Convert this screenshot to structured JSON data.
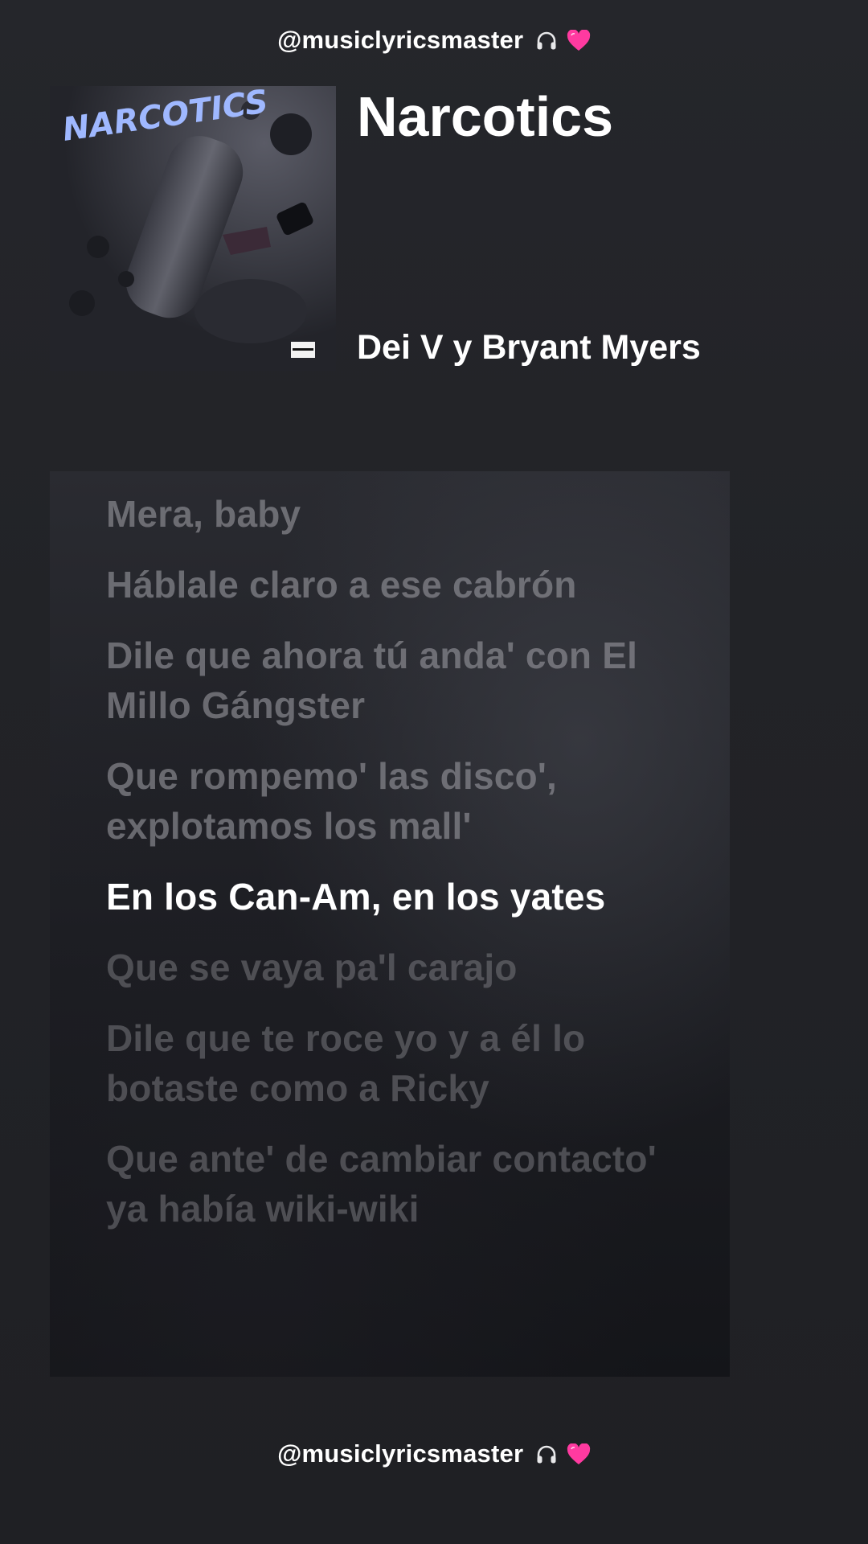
{
  "watermark": {
    "handle": "@musiclyricsmaster",
    "emoji_icons": [
      "headphones-icon",
      "pink-heart-icon"
    ]
  },
  "song": {
    "title": "Narcotics",
    "artist": "Dei V y Bryant Myers",
    "cover_text": "NARCOTICS"
  },
  "lyrics": {
    "lines": [
      {
        "text": "Mera, baby",
        "state": "past"
      },
      {
        "text": "Háblale claro a ese cabrón",
        "state": "past"
      },
      {
        "text": "Dile que ahora tú anda' con El Millo Gángster",
        "state": "past"
      },
      {
        "text": "Que rompemo' las disco', explotamos los mall'",
        "state": "past"
      },
      {
        "text": "En los Can-Am, en los yates",
        "state": "active"
      },
      {
        "text": "Que se vaya pa'l carajo",
        "state": "upcoming"
      },
      {
        "text": "Dile que te roce yo y a él lo botaste como a Ricky",
        "state": "upcoming"
      },
      {
        "text": "Que ante' de cambiar contacto' ya había wiki-wiki",
        "state": "upcoming"
      }
    ]
  },
  "colors": {
    "background": "#232328",
    "active_lyric": "#ffffff",
    "heart": "#ff3aa0",
    "cover_title": "#9fb8ff"
  }
}
